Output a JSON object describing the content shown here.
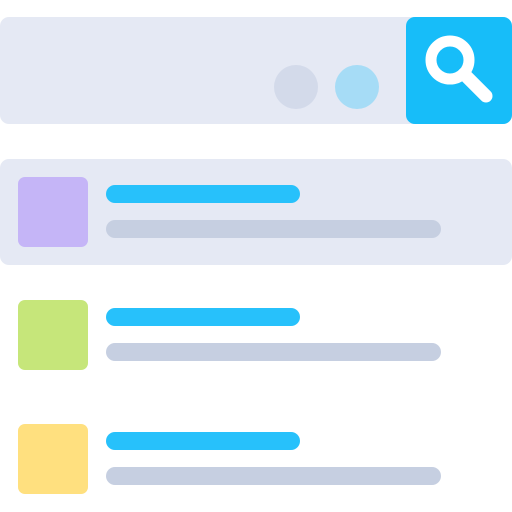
{
  "colors": {
    "search_bar_bg": "#e5e9f4",
    "selected_row_bg": "#e5e9f4",
    "row_bg": "#ffffff",
    "dot_inactive": "#d3daea",
    "dot_active": "#a6dcf6",
    "accent": "#17bdf9",
    "icon_fg": "#ffffff",
    "title_line": "#27c1fb",
    "subtitle_line": "#c6cfe1"
  },
  "search": {
    "button_icon": "magnifier-icon"
  },
  "list": {
    "items": [
      {
        "selected": true,
        "thumb_color": "#c5b5f7"
      },
      {
        "selected": false,
        "thumb_color": "#c6e67a"
      },
      {
        "selected": false,
        "thumb_color": "#ffe07f"
      }
    ]
  }
}
